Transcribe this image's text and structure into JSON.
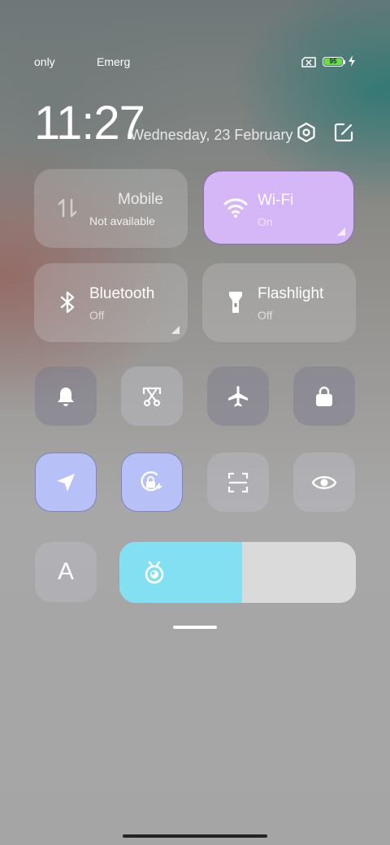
{
  "status_bar": {
    "carrier_1": "only",
    "carrier_2": "Emerg",
    "battery_level": "95",
    "sim_icon": "no-sim-icon",
    "charging_icon": "lightning-bolt-icon"
  },
  "header": {
    "time": "11:27",
    "date": "Wednesday, 23 February",
    "settings_icon": "settings-hexagon-icon",
    "edit_icon": "edit-icon"
  },
  "tiles": [
    {
      "label": "Mobile",
      "sub": "Not available",
      "icon": "mobile-data-icon",
      "active": false
    },
    {
      "label": "Wi-Fi",
      "sub": "On",
      "icon": "wifi-icon",
      "active": true
    },
    {
      "label": "Bluetooth",
      "sub": "Off",
      "icon": "bluetooth-icon",
      "active": false
    },
    {
      "label": "Flashlight",
      "sub": "Off",
      "icon": "flashlight-icon",
      "active": false
    }
  ],
  "toggles_row1": [
    {
      "icon": "bell-icon",
      "active": false
    },
    {
      "icon": "screenshot-icon",
      "active": false
    },
    {
      "icon": "airplane-icon",
      "active": false
    },
    {
      "icon": "lock-icon",
      "active": false
    }
  ],
  "toggles_row2": [
    {
      "icon": "location-icon",
      "active": true
    },
    {
      "icon": "rotation-lock-icon",
      "active": true
    },
    {
      "icon": "scan-icon",
      "active": false
    },
    {
      "icon": "eye-icon",
      "active": false
    }
  ],
  "auto_brightness": {
    "label": "A"
  },
  "brightness": {
    "level": 0.52,
    "icon": "brightness-icon"
  },
  "colors": {
    "active_tile": "#d5b7f7",
    "active_toggle": "#b7c1f8",
    "brightness_fill": "#83e0f3",
    "battery_fill": "#6be043"
  }
}
